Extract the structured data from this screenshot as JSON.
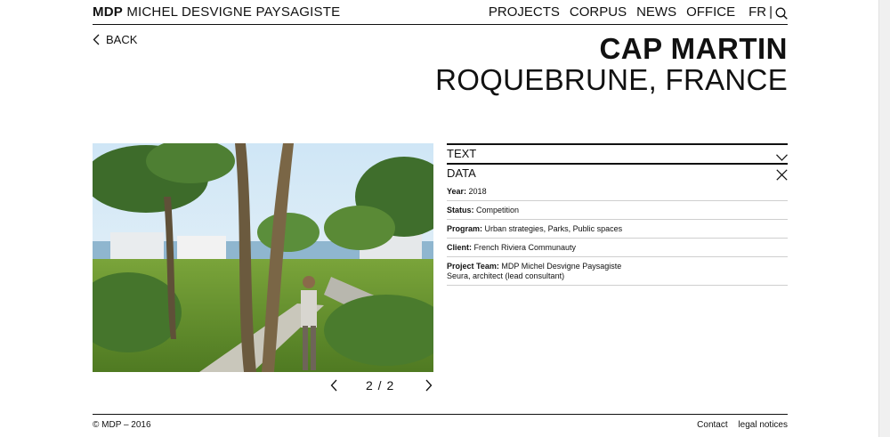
{
  "header": {
    "brand_bold": "MDP",
    "brand_rest": "MICHEL DESVIGNE PAYSAGISTE",
    "nav": [
      "PROJECTS",
      "CORPUS",
      "NEWS",
      "OFFICE"
    ],
    "lang": "FR",
    "sep": "|"
  },
  "back_label": "BACK",
  "project": {
    "name": "CAP MARTIN",
    "location": "ROQUEBRUNE, FRANCE"
  },
  "gallery": {
    "counter": "2 / 2"
  },
  "accordion": {
    "text_label": "TEXT",
    "data_label": "DATA",
    "rows": [
      {
        "label": "Year:",
        "value": "2018"
      },
      {
        "label": "Status:",
        "value": "Competition"
      },
      {
        "label": "Program:",
        "value": "Urban strategies, Parks, Public spaces"
      },
      {
        "label": "Client:",
        "value": "French Riviera Communauty"
      },
      {
        "label": "Project Team:",
        "value": "MDP Michel Desvigne Paysagiste",
        "value2": "Seura, architect (lead consultant)"
      }
    ]
  },
  "footer": {
    "copyright": "© MDP – 2016",
    "contact": "Contact",
    "legal": "legal notices"
  },
  "icons": {
    "search": "search-icon",
    "back": "chevron-left-icon",
    "prev": "chevron-left-icon",
    "next": "chevron-right-icon",
    "expand": "chevron-down-icon",
    "close": "close-icon"
  }
}
